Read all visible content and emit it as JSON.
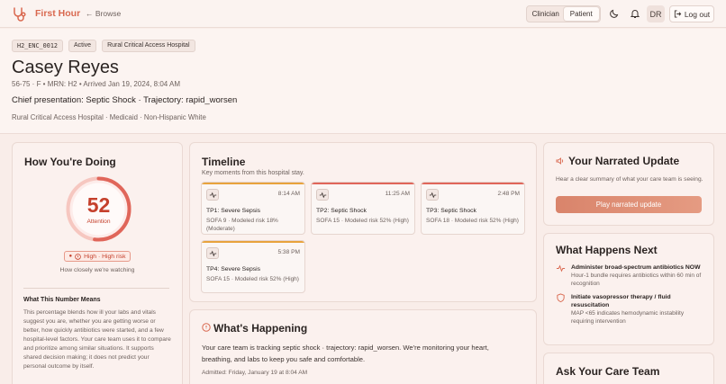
{
  "app": {
    "brand": "First Hour",
    "browse_label": "← Browse"
  },
  "topbar": {
    "clinician_label": "Clinician",
    "patient_label": "Patient",
    "avatar_initials": "DR",
    "logout_label": "Log out"
  },
  "encounter": {
    "id": "H2_ENC_0012",
    "status": "Active",
    "facility_chip": "Rural Critical Access Hospital",
    "patient_name": "Casey Reyes",
    "meta": "56-75 · F • MRN: H2 • Arrived Jan 19, 2024, 8:04 AM",
    "chief_presentation": "Chief presentation: Septic Shock · Trajectory: rapid_worsen",
    "demographics": "Rural Critical Access Hospital · Medicaid · Non-Hispanic White"
  },
  "how_doing": {
    "title": "How You're Doing",
    "score": "52",
    "score_fraction": 0.52,
    "score_label": "Attention",
    "risk_badge": "High · High risk",
    "watching_text": "How closely we're watching",
    "meaning_title": "What This Number Means",
    "meaning_text": "This percentage blends how ill your labs and vitals suggest you are, whether you are getting worse or better, how quickly antibiotics were started, and a few hospital-level factors. Your care team uses it to compare and prioritize among similar situations. It supports shared decision making; it does not predict your personal outcome by itself."
  },
  "timeline": {
    "title": "Timeline",
    "subtitle": "Key moments from this hospital stay.",
    "events": [
      {
        "time": "8:14 AM",
        "title": "TP1: Severe Sepsis",
        "detail": "SOFA 9 · Modeled risk 18% (Moderate)",
        "color": "#e8a33c"
      },
      {
        "time": "11:25 AM",
        "title": "TP2: Septic Shock",
        "detail": "SOFA 15 · Modeled risk 52% (High)",
        "color": "#e0665a"
      },
      {
        "time": "2:48 PM",
        "title": "TP3: Septic Shock",
        "detail": "SOFA 18 · Modeled risk 52% (High)",
        "color": "#e0665a"
      },
      {
        "time": "5:38 PM",
        "title": "TP4: Severe Sepsis",
        "detail": "SOFA 15 · Modeled risk 52% (High)",
        "color": "#e8a33c"
      }
    ]
  },
  "happening": {
    "title": "What's Happening",
    "body": "Your care team is tracking septic shock · trajectory: rapid_worsen. We're monitoring your heart, breathing, and labs to keep you safe and comfortable.",
    "admitted": "Admitted: Friday, January 19 at 8:04 AM"
  },
  "narrated": {
    "title": "Your Narrated Update",
    "body": "Hear a clear summary of what your care team is seeing.",
    "play_label": "Play narrated update"
  },
  "next": {
    "title": "What Happens Next",
    "items": [
      {
        "title": "Administer broad-spectrum antibiotics NOW",
        "detail": "Hour-1 bundle requires antibiotics within 60 min of recognition"
      },
      {
        "title": "Initiate vasopressor therapy / fluid resuscitation",
        "detail": "MAP <65 indicates hemodynamic instability requiring intervention"
      }
    ]
  },
  "ask": {
    "title": "Ask Your Care Team"
  },
  "colors": {
    "accent": "#d9684f",
    "high_risk": "#c5402c",
    "gauge": "#e0665a"
  }
}
